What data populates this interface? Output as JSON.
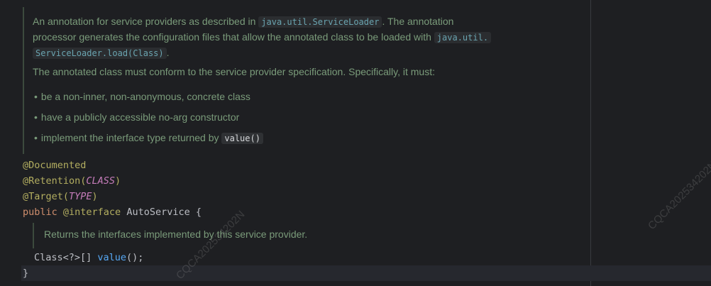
{
  "doc": {
    "p1_a": "An annotation for service providers as described in ",
    "p1_code1": "java.util.ServiceLoader",
    "p1_b": ". The annotation",
    "p1_c": "processor generates the configuration files that allow the annotated class to be loaded with ",
    "p1_code2a": "java.util.",
    "p1_code2b": "ServiceLoader.load(Class)",
    "p1_d": ".",
    "p2": "The annotated class must conform to the service provider specification. Specifically, it must:",
    "bullets": [
      "be a non-inner, non-anonymous, concrete class",
      "have a publicly accessible no-arg constructor",
      "implement the interface type returned by "
    ],
    "bullet3_code": "value()"
  },
  "code": {
    "line1": "@Documented",
    "line2_ann": "@Retention(",
    "line2_const": "CLASS",
    "line2_end": ")",
    "line3_ann": "@Target(",
    "line3_const": "TYPE",
    "line3_end": ")",
    "line4_kw": "public ",
    "line4_ann": "@interface ",
    "line4_name": "AutoService ",
    "line4_brace": "{",
    "inner_doc": "Returns the interfaces implemented by this service provider.",
    "line5_type": "Class<?>[] ",
    "line5_method": "value",
    "line5_end": "();",
    "line6": "}"
  },
  "watermark": "CQCA202534202N"
}
